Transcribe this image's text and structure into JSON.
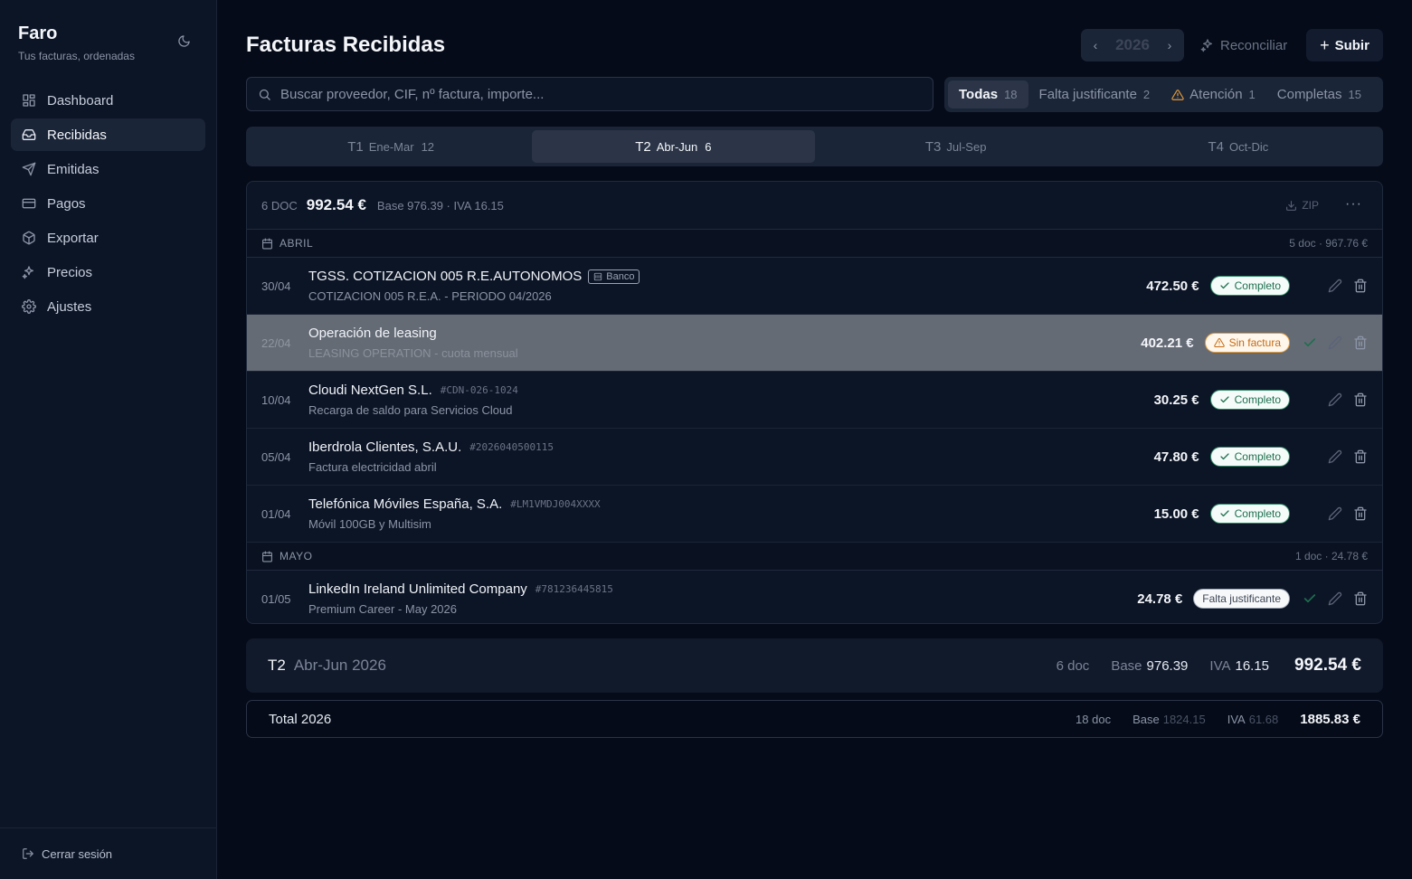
{
  "brand": {
    "title": "Faro",
    "subtitle": "Tus facturas, ordenadas"
  },
  "nav": [
    {
      "label": "Dashboard",
      "icon": "dashboard-icon"
    },
    {
      "label": "Recibidas",
      "icon": "inbox-icon",
      "active": true
    },
    {
      "label": "Emitidas",
      "icon": "send-icon"
    },
    {
      "label": "Pagos",
      "icon": "credit-card-icon"
    },
    {
      "label": "Exportar",
      "icon": "package-icon"
    },
    {
      "label": "Precios",
      "icon": "sparkles-icon"
    },
    {
      "label": "Ajustes",
      "icon": "gear-icon"
    }
  ],
  "logout_label": "Cerrar sesión",
  "header": {
    "title": "Facturas Recibidas",
    "year": "2026",
    "reconcile_label": "Reconciliar",
    "upload_label": "Subir"
  },
  "search": {
    "placeholder": "Buscar proveedor, CIF, nº factura, importe..."
  },
  "filters": [
    {
      "label": "Todas",
      "count": "18",
      "active": true
    },
    {
      "label": "Falta justificante",
      "count": "2"
    },
    {
      "label": "Atención",
      "count": "1",
      "icon": "warning-icon"
    },
    {
      "label": "Completas",
      "count": "15"
    }
  ],
  "quarters": [
    {
      "name": "T1",
      "range": "Ene-Mar",
      "count": "12"
    },
    {
      "name": "T2",
      "range": "Abr-Jun",
      "count": "6",
      "active": true
    },
    {
      "name": "T3",
      "range": "Jul-Sep",
      "count": ""
    },
    {
      "name": "T4",
      "range": "Oct-Dic",
      "count": ""
    }
  ],
  "card": {
    "docs": "6 DOC",
    "amount": "992.54 €",
    "base_iva": "Base 976.39 · IVA 16.15",
    "zip_label": "ZIP",
    "more_label": "···"
  },
  "months": [
    {
      "label": "ABRIL",
      "summary": "5 doc · 967.76 €",
      "rows": [
        {
          "date": "30/04",
          "name": "TGSS. COTIZACION 005 R.E.AUTONOMOS",
          "ref": "",
          "bank": "Banco",
          "desc": "COTIZACION 005 R.E.A. - PERIODO 04/2026",
          "amount": "472.50 €",
          "status": "Completo",
          "status_type": "ok",
          "check": false
        },
        {
          "date": "22/04",
          "name": "Operación de leasing",
          "ref": "",
          "bank": "",
          "desc": "LEASING OPERATION - cuota mensual",
          "amount": "402.21 €",
          "status": "Sin factura",
          "status_type": "warn",
          "check": true,
          "highlighted": true
        },
        {
          "date": "10/04",
          "name": "Cloudi NextGen S.L.",
          "ref": "#CDN-026-1024",
          "bank": "",
          "desc": "Recarga de saldo para Servicios Cloud",
          "amount": "30.25 €",
          "status": "Completo",
          "status_type": "ok",
          "check": false
        },
        {
          "date": "05/04",
          "name": "Iberdrola Clientes, S.A.U.",
          "ref": "#2026040500115",
          "bank": "",
          "desc": "Factura electricidad abril",
          "amount": "47.80 €",
          "status": "Completo",
          "status_type": "ok",
          "check": false
        },
        {
          "date": "01/04",
          "name": "Telefónica Móviles España, S.A.",
          "ref": "#LM1VMDJ004XXXX",
          "bank": "",
          "desc": "Móvil 100GB y Multisim",
          "amount": "15.00 €",
          "status": "Completo",
          "status_type": "ok",
          "check": false
        }
      ]
    },
    {
      "label": "MAYO",
      "summary": "1 doc · 24.78 €",
      "rows": [
        {
          "date": "01/05",
          "name": "LinkedIn Ireland Unlimited Company",
          "ref": "#781236445815",
          "bank": "",
          "desc": "Premium Career - May 2026",
          "amount": "24.78 €",
          "status": "Falta justificante",
          "status_type": "miss",
          "check": true
        }
      ]
    }
  ],
  "quarter_summary": {
    "quarter": "T2",
    "range": "Abr-Jun 2026",
    "docs": "6 doc",
    "base_label": "Base",
    "base": "976.39",
    "iva_label": "IVA",
    "iva": "16.15",
    "total": "992.54 €"
  },
  "year_total": {
    "label": "Total 2026",
    "docs": "18 doc",
    "base_label": "Base",
    "base": "1824.15",
    "iva_label": "IVA",
    "iva": "61.68",
    "total": "1885.83 €"
  },
  "colors": {
    "ok": "#2f8a67",
    "warn": "#e49b3a",
    "background": "#050b18",
    "sidebar": "#0c1526"
  }
}
